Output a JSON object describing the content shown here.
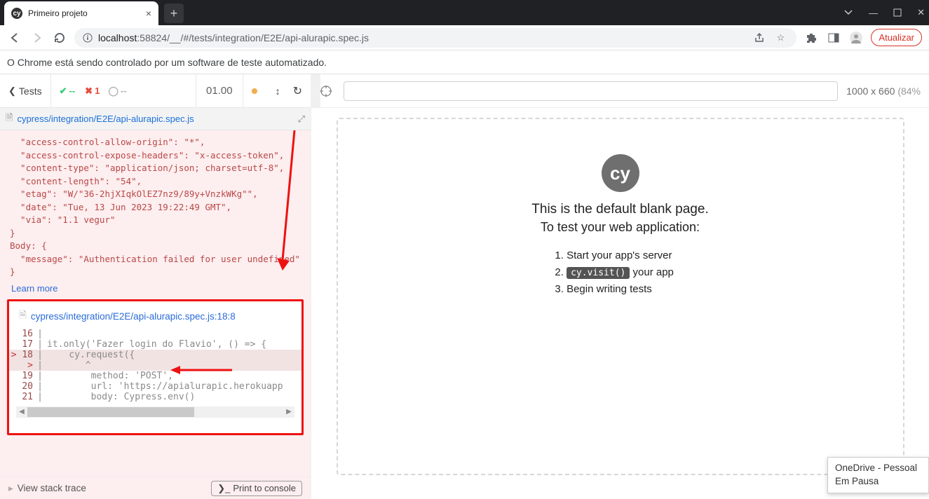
{
  "browser": {
    "tab_title": "Primeiro projeto",
    "url_display_host": "localhost",
    "url_display_path": ":58824/__/#/tests/integration/E2E/api-alurapic.spec.js",
    "update_button": "Atualizar",
    "automation_banner": "O Chrome está sendo controlado por um software de teste automatizado."
  },
  "cypress": {
    "back_label": "Tests",
    "passed": "--",
    "failed": "1",
    "pending": "--",
    "duration": "01.00",
    "spec_path": "cypress/integration/E2E/api-alurapic.spec.js",
    "error_lines": [
      "  \"access-control-allow-origin\": \"*\",",
      "  \"access-control-expose-headers\": \"x-access-token\",",
      "  \"content-type\": \"application/json; charset=utf-8\",",
      "  \"content-length\": \"54\",",
      "  \"etag\": \"W/\"36-2hjXIqkOlEZ7nz9/89y+VnzkWKg\"\",",
      "  \"date\": \"Tue, 13 Jun 2023 19:22:49 GMT\",",
      "  \"via\": \"1.1 vegur\"",
      "}",
      "Body: {",
      "  \"message\": \"Authentication failed for user undefined\"",
      "}"
    ],
    "learn_more": "Learn more",
    "code_location": "cypress/integration/E2E/api-alurapic.spec.js:18:8",
    "code_rows": [
      {
        "n": "16",
        "src": "",
        "active": false
      },
      {
        "n": "17",
        "src": "it.only('Fazer login do Flavio', () => {",
        "active": false
      },
      {
        "n": "18",
        "src": "    cy.request({",
        "active": true
      },
      {
        "n": "",
        "src": "       ^",
        "active": true
      },
      {
        "n": "19",
        "src": "        method: 'POST',",
        "active": false
      },
      {
        "n": "20",
        "src": "        url: 'https://apialurapic.herokuapp",
        "active": false
      },
      {
        "n": "21",
        "src": "        body: Cypress.env()",
        "active": false
      }
    ],
    "stack_trace_label": "View stack trace",
    "print_console_label": "Print to console"
  },
  "aut": {
    "viewport_label": "1000 x 660",
    "viewport_scale": "(84%",
    "blank_line1": "This is the default blank page.",
    "blank_line2": "To test your web application:",
    "steps": {
      "s1": "Start your app's server",
      "s2a": "cy.visit()",
      "s2b": " your app",
      "s3": "Begin writing tests"
    }
  },
  "toast": {
    "line1": "OneDrive - Pessoal",
    "line2": "Em Pausa"
  }
}
